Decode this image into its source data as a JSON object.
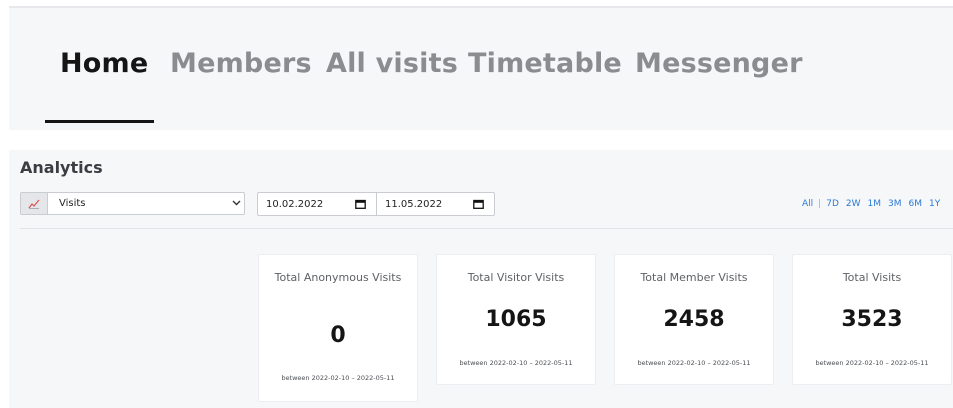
{
  "nav": {
    "tabs": [
      "Home",
      "Members",
      "All visits",
      "Timetable",
      "Messenger"
    ],
    "active": "Home"
  },
  "analytics": {
    "title": "Analytics",
    "metric": {
      "selected": "Visits",
      "icon": "line-chart-icon"
    },
    "date_from": "10.02.2022",
    "date_to": "11.05.2022",
    "ranges": [
      "All",
      "7D",
      "2W",
      "1M",
      "3M",
      "6M",
      "1Y"
    ]
  },
  "cards": [
    {
      "title": "Total Anonymous Visits",
      "value": "0",
      "range": "between 2022-02-10 – 2022-05-11"
    },
    {
      "title": "Total Visitor Visits",
      "value": "1065",
      "range": "between 2022-02-10 – 2022-05-11"
    },
    {
      "title": "Total Member Visits",
      "value": "2458",
      "range": "between 2022-02-10 – 2022-05-11"
    },
    {
      "title": "Total Visits",
      "value": "3523",
      "range": "between 2022-02-10 – 2022-05-11"
    }
  ],
  "colors": {
    "accent": "#2b7ad4",
    "active_tab": "#151515",
    "inactive_tab": "#8a8c8f",
    "panel_bg": "#f6f7f9"
  }
}
